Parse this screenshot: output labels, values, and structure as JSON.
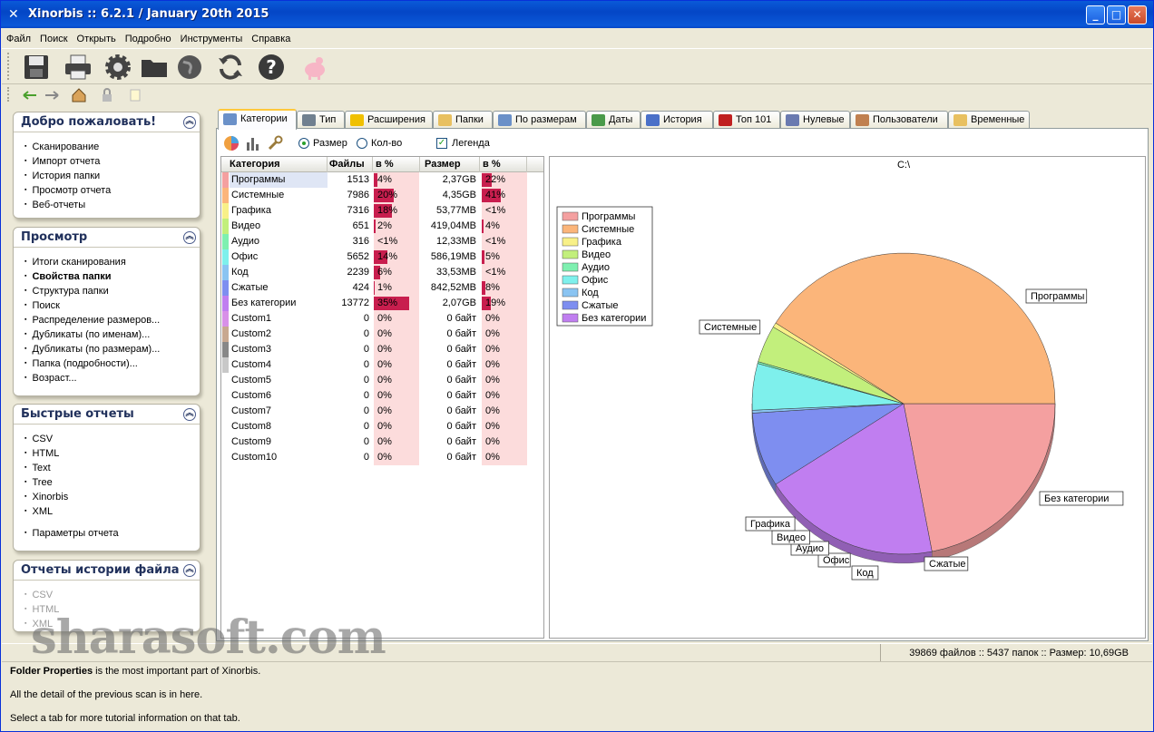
{
  "window": {
    "title": "Xinorbis :: 6.2.1 / January 20th 2015",
    "buttons": [
      "_",
      "□",
      "✕"
    ]
  },
  "menu": [
    "Файл",
    "Поиск",
    "Открыть",
    "Подробно",
    "Инструменты",
    "Справка"
  ],
  "sidebar": {
    "panels": [
      {
        "title": "Добро пожаловать!",
        "items": [
          {
            "label": "Сканирование"
          },
          {
            "label": "Импорт отчета"
          },
          {
            "label": "История папки"
          },
          {
            "label": "Просмотр отчета"
          },
          {
            "label": "Веб-отчеты"
          }
        ]
      },
      {
        "title": "Просмотр",
        "items": [
          {
            "label": "Итоги сканирования"
          },
          {
            "label": "Свойства папки",
            "bold": true
          },
          {
            "label": "Структура папки"
          },
          {
            "label": "Поиск"
          },
          {
            "label": "Распределение размеров..."
          },
          {
            "label": "Дубликаты (по именам)..."
          },
          {
            "label": "Дубликаты (по размерам)..."
          },
          {
            "label": "Папка (подробности)..."
          },
          {
            "label": "Возраст..."
          }
        ]
      },
      {
        "title": "Быстрые отчеты",
        "items": [
          {
            "label": "CSV"
          },
          {
            "label": "HTML"
          },
          {
            "label": "Text"
          },
          {
            "label": "Tree"
          },
          {
            "label": "Xinorbis"
          },
          {
            "label": "XML"
          },
          {
            "label": "Параметры отчета",
            "gap": true
          }
        ]
      },
      {
        "title": "Отчеты истории файла",
        "items": [
          {
            "label": "CSV",
            "disabled": true
          },
          {
            "label": "HTML",
            "disabled": true
          },
          {
            "label": "XML",
            "disabled": true
          }
        ]
      }
    ]
  },
  "tabs": [
    {
      "label": "Категории",
      "active": true,
      "icon": "categories-icon"
    },
    {
      "label": "Тип",
      "icon": "type-icon"
    },
    {
      "label": "Расширения",
      "icon": "extensions-icon"
    },
    {
      "label": "Папки",
      "icon": "folders-icon"
    },
    {
      "label": "По размерам",
      "icon": "sizes-icon"
    },
    {
      "label": "Даты",
      "icon": "dates-icon"
    },
    {
      "label": "История",
      "icon": "history-icon"
    },
    {
      "label": "Топ 101",
      "icon": "top101-icon"
    },
    {
      "label": "Нулевые",
      "icon": "null-files-icon"
    },
    {
      "label": "Пользователи",
      "icon": "users-icon"
    },
    {
      "label": "Временные",
      "icon": "temp-icon"
    }
  ],
  "options": {
    "size_label": "Размер",
    "count_label": "Кол-во",
    "legend_label": "Легенда",
    "size_selected": true,
    "legend_checked": true
  },
  "table": {
    "headers": [
      "Категория",
      "Файлы",
      "в %",
      "Размер",
      "в %"
    ],
    "rows": [
      {
        "name": "Программы",
        "files": "1513",
        "fpct": "4%",
        "fbar": 4,
        "size": "2,37GB",
        "spct": "22%",
        "sbar": 22,
        "color": "#f4a0a0"
      },
      {
        "name": "Системные",
        "files": "7986",
        "fpct": "20%",
        "fbar": 20,
        "size": "4,35GB",
        "spct": "41%",
        "sbar": 41,
        "color": "#fbb57a"
      },
      {
        "name": "Графика",
        "files": "7316",
        "fpct": "18%",
        "fbar": 18,
        "size": "53,77MB",
        "spct": "<1%",
        "sbar": 0,
        "color": "#f8f088"
      },
      {
        "name": "Видео",
        "files": "651",
        "fpct": "2%",
        "fbar": 2,
        "size": "419,04MB",
        "spct": "4%",
        "sbar": 4,
        "color": "#c2ef7c"
      },
      {
        "name": "Аудио",
        "files": "316",
        "fpct": "<1%",
        "fbar": 0,
        "size": "12,33MB",
        "spct": "<1%",
        "sbar": 0,
        "color": "#7ef0b0"
      },
      {
        "name": "Офис",
        "files": "5652",
        "fpct": "14%",
        "fbar": 14,
        "size": "586,19MB",
        "spct": "5%",
        "sbar": 5,
        "color": "#7ef0ec"
      },
      {
        "name": "Код",
        "files": "2239",
        "fpct": "6%",
        "fbar": 6,
        "size": "33,53MB",
        "spct": "<1%",
        "sbar": 0,
        "color": "#8ac4f2"
      },
      {
        "name": "Сжатые",
        "files": "424",
        "fpct": "1%",
        "fbar": 1,
        "size": "842,52MB",
        "spct": "8%",
        "sbar": 8,
        "color": "#7e8ef0"
      },
      {
        "name": "Без категории",
        "files": "13772",
        "fpct": "35%",
        "fbar": 35,
        "size": "2,07GB",
        "spct": "19%",
        "sbar": 19,
        "color": "#c07ef0"
      },
      {
        "name": "Custom1",
        "files": "0",
        "fpct": "0%",
        "fbar": 0,
        "size": "0 байт",
        "spct": "0%",
        "sbar": 0,
        "color": "#d890e8"
      },
      {
        "name": "Custom2",
        "files": "0",
        "fpct": "0%",
        "fbar": 0,
        "size": "0 байт",
        "spct": "0%",
        "sbar": 0,
        "color": "#c8a890"
      },
      {
        "name": "Custom3",
        "files": "0",
        "fpct": "0%",
        "fbar": 0,
        "size": "0 байт",
        "spct": "0%",
        "sbar": 0,
        "color": "#888888"
      },
      {
        "name": "Custom4",
        "files": "0",
        "fpct": "0%",
        "fbar": 0,
        "size": "0 байт",
        "spct": "0%",
        "sbar": 0,
        "color": "#c8c8c8"
      },
      {
        "name": "Custom5",
        "files": "0",
        "fpct": "0%",
        "fbar": 0,
        "size": "0 байт",
        "spct": "0%",
        "sbar": 0,
        "color": "#ffffff"
      },
      {
        "name": "Custom6",
        "files": "0",
        "fpct": "0%",
        "fbar": 0,
        "size": "0 байт",
        "spct": "0%",
        "sbar": 0,
        "color": "#ffffff"
      },
      {
        "name": "Custom7",
        "files": "0",
        "fpct": "0%",
        "fbar": 0,
        "size": "0 байт",
        "spct": "0%",
        "sbar": 0,
        "color": "#ffffff"
      },
      {
        "name": "Custom8",
        "files": "0",
        "fpct": "0%",
        "fbar": 0,
        "size": "0 байт",
        "spct": "0%",
        "sbar": 0,
        "color": "#ffffff"
      },
      {
        "name": "Custom9",
        "files": "0",
        "fpct": "0%",
        "fbar": 0,
        "size": "0 байт",
        "spct": "0%",
        "sbar": 0,
        "color": "#ffffff"
      },
      {
        "name": "Custom10",
        "files": "0",
        "fpct": "0%",
        "fbar": 0,
        "size": "0 байт",
        "spct": "0%",
        "sbar": 0,
        "color": "#ffffff"
      }
    ]
  },
  "chart_data": {
    "type": "pie",
    "title": "C:\\",
    "legend_position": "top-left",
    "slices": [
      {
        "label": "Программы",
        "value": 22,
        "color": "#f4a0a0"
      },
      {
        "label": "Без категории",
        "value": 19,
        "color": "#c07ef0"
      },
      {
        "label": "Сжатые",
        "value": 8,
        "color": "#7e8ef0"
      },
      {
        "label": "Код",
        "value": 0.3,
        "color": "#8ac4f2"
      },
      {
        "label": "Офис",
        "value": 5,
        "color": "#7ef0ec"
      },
      {
        "label": "Аудио",
        "value": 0.2,
        "color": "#7ef0b0"
      },
      {
        "label": "Видео",
        "value": 4,
        "color": "#c2ef7c"
      },
      {
        "label": "Графика",
        "value": 0.5,
        "color": "#f8f088"
      },
      {
        "label": "Системные",
        "value": 41,
        "color": "#fbb57a"
      }
    ],
    "legend": [
      {
        "label": "Программы",
        "color": "#f4a0a0"
      },
      {
        "label": "Системные",
        "color": "#fbb57a"
      },
      {
        "label": "Графика",
        "color": "#f8f088"
      },
      {
        "label": "Видео",
        "color": "#c2ef7c"
      },
      {
        "label": "Аудио",
        "color": "#7ef0b0"
      },
      {
        "label": "Офис",
        "color": "#7ef0ec"
      },
      {
        "label": "Код",
        "color": "#8ac4f2"
      },
      {
        "label": "Сжатые",
        "color": "#7e8ef0"
      },
      {
        "label": "Без категории",
        "color": "#c07ef0"
      }
    ]
  },
  "status": {
    "text": "39869 файлов  ::  5437 папок  ::  Размер: 10,69GB"
  },
  "help": {
    "line1_bold": "Folder Properties",
    "line1_rest": " is the most important part of Xinorbis.",
    "line2": "All the detail of the previous scan is in here.",
    "line3": "Select a tab for more tutorial information on that tab."
  },
  "watermark": "sharasoft.com"
}
